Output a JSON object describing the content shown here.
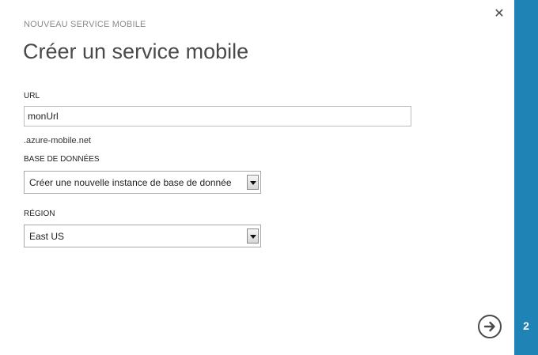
{
  "wizard": {
    "eyebrow": "NOUVEAU SERVICE MOBILE",
    "title": "Créer un service mobile",
    "close_icon": "close-icon",
    "next_icon": "arrow-right-circle-icon",
    "step": "2",
    "sidebar_color": "#1f84b5"
  },
  "url": {
    "label": "URL",
    "value": "monUrl",
    "suffix": ".azure-mobile.net"
  },
  "database": {
    "label": "BASE DE DONNÉES",
    "selected": "Créer une nouvelle instance de base de donnée"
  },
  "region": {
    "label": "RÉGION",
    "selected": "East US"
  }
}
